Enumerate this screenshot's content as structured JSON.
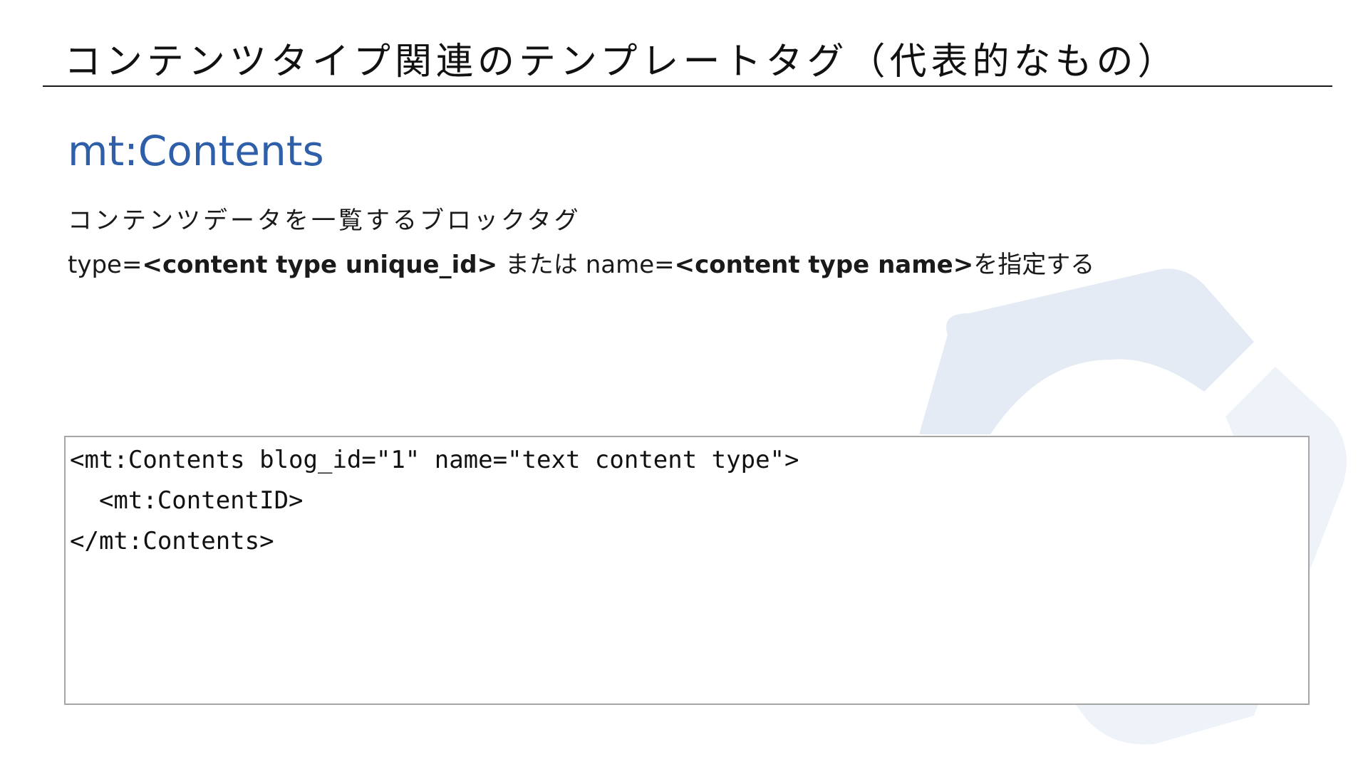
{
  "slide": {
    "title": "コンテンツタイプ関連のテンプレートタグ（代表的なもの）",
    "heading": "mt:Contents",
    "description_line1": "コンテンツデータを一覧するブロックタグ",
    "description_line2": {
      "part1": "type=",
      "part2_bold": "<content type unique_id>",
      "part3": " または name=",
      "part4_bold": "<content type name>",
      "part5": "を指定する"
    },
    "code_lines": [
      "<mt:Contents blog_id=\"1\" name=\"text content type\">",
      "  <mt:ContentID>",
      "</mt:Contents>"
    ]
  },
  "colors": {
    "heading": "#2f5fa8",
    "logo_light": "#e4ebf5",
    "logo_lighter": "#eef3fa"
  }
}
